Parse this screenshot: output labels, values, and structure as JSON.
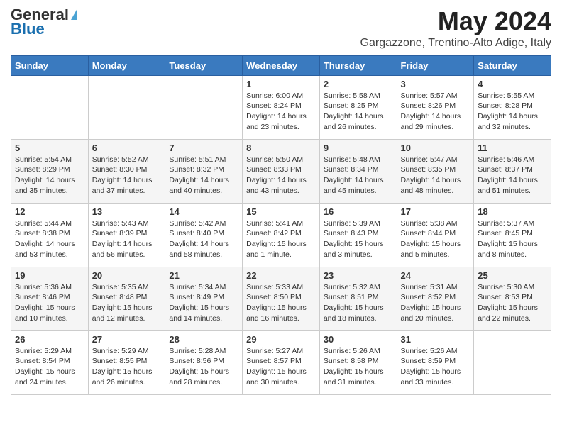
{
  "logo": {
    "general": "General",
    "blue": "Blue"
  },
  "header": {
    "month": "May 2024",
    "location": "Gargazzone, Trentino-Alto Adige, Italy"
  },
  "days_of_week": [
    "Sunday",
    "Monday",
    "Tuesday",
    "Wednesday",
    "Thursday",
    "Friday",
    "Saturday"
  ],
  "weeks": [
    [
      {
        "day": "",
        "info": ""
      },
      {
        "day": "",
        "info": ""
      },
      {
        "day": "",
        "info": ""
      },
      {
        "day": "1",
        "info": "Sunrise: 6:00 AM\nSunset: 8:24 PM\nDaylight: 14 hours\nand 23 minutes."
      },
      {
        "day": "2",
        "info": "Sunrise: 5:58 AM\nSunset: 8:25 PM\nDaylight: 14 hours\nand 26 minutes."
      },
      {
        "day": "3",
        "info": "Sunrise: 5:57 AM\nSunset: 8:26 PM\nDaylight: 14 hours\nand 29 minutes."
      },
      {
        "day": "4",
        "info": "Sunrise: 5:55 AM\nSunset: 8:28 PM\nDaylight: 14 hours\nand 32 minutes."
      }
    ],
    [
      {
        "day": "5",
        "info": "Sunrise: 5:54 AM\nSunset: 8:29 PM\nDaylight: 14 hours\nand 35 minutes."
      },
      {
        "day": "6",
        "info": "Sunrise: 5:52 AM\nSunset: 8:30 PM\nDaylight: 14 hours\nand 37 minutes."
      },
      {
        "day": "7",
        "info": "Sunrise: 5:51 AM\nSunset: 8:32 PM\nDaylight: 14 hours\nand 40 minutes."
      },
      {
        "day": "8",
        "info": "Sunrise: 5:50 AM\nSunset: 8:33 PM\nDaylight: 14 hours\nand 43 minutes."
      },
      {
        "day": "9",
        "info": "Sunrise: 5:48 AM\nSunset: 8:34 PM\nDaylight: 14 hours\nand 45 minutes."
      },
      {
        "day": "10",
        "info": "Sunrise: 5:47 AM\nSunset: 8:35 PM\nDaylight: 14 hours\nand 48 minutes."
      },
      {
        "day": "11",
        "info": "Sunrise: 5:46 AM\nSunset: 8:37 PM\nDaylight: 14 hours\nand 51 minutes."
      }
    ],
    [
      {
        "day": "12",
        "info": "Sunrise: 5:44 AM\nSunset: 8:38 PM\nDaylight: 14 hours\nand 53 minutes."
      },
      {
        "day": "13",
        "info": "Sunrise: 5:43 AM\nSunset: 8:39 PM\nDaylight: 14 hours\nand 56 minutes."
      },
      {
        "day": "14",
        "info": "Sunrise: 5:42 AM\nSunset: 8:40 PM\nDaylight: 14 hours\nand 58 minutes."
      },
      {
        "day": "15",
        "info": "Sunrise: 5:41 AM\nSunset: 8:42 PM\nDaylight: 15 hours\nand 1 minute."
      },
      {
        "day": "16",
        "info": "Sunrise: 5:39 AM\nSunset: 8:43 PM\nDaylight: 15 hours\nand 3 minutes."
      },
      {
        "day": "17",
        "info": "Sunrise: 5:38 AM\nSunset: 8:44 PM\nDaylight: 15 hours\nand 5 minutes."
      },
      {
        "day": "18",
        "info": "Sunrise: 5:37 AM\nSunset: 8:45 PM\nDaylight: 15 hours\nand 8 minutes."
      }
    ],
    [
      {
        "day": "19",
        "info": "Sunrise: 5:36 AM\nSunset: 8:46 PM\nDaylight: 15 hours\nand 10 minutes."
      },
      {
        "day": "20",
        "info": "Sunrise: 5:35 AM\nSunset: 8:48 PM\nDaylight: 15 hours\nand 12 minutes."
      },
      {
        "day": "21",
        "info": "Sunrise: 5:34 AM\nSunset: 8:49 PM\nDaylight: 15 hours\nand 14 minutes."
      },
      {
        "day": "22",
        "info": "Sunrise: 5:33 AM\nSunset: 8:50 PM\nDaylight: 15 hours\nand 16 minutes."
      },
      {
        "day": "23",
        "info": "Sunrise: 5:32 AM\nSunset: 8:51 PM\nDaylight: 15 hours\nand 18 minutes."
      },
      {
        "day": "24",
        "info": "Sunrise: 5:31 AM\nSunset: 8:52 PM\nDaylight: 15 hours\nand 20 minutes."
      },
      {
        "day": "25",
        "info": "Sunrise: 5:30 AM\nSunset: 8:53 PM\nDaylight: 15 hours\nand 22 minutes."
      }
    ],
    [
      {
        "day": "26",
        "info": "Sunrise: 5:29 AM\nSunset: 8:54 PM\nDaylight: 15 hours\nand 24 minutes."
      },
      {
        "day": "27",
        "info": "Sunrise: 5:29 AM\nSunset: 8:55 PM\nDaylight: 15 hours\nand 26 minutes."
      },
      {
        "day": "28",
        "info": "Sunrise: 5:28 AM\nSunset: 8:56 PM\nDaylight: 15 hours\nand 28 minutes."
      },
      {
        "day": "29",
        "info": "Sunrise: 5:27 AM\nSunset: 8:57 PM\nDaylight: 15 hours\nand 30 minutes."
      },
      {
        "day": "30",
        "info": "Sunrise: 5:26 AM\nSunset: 8:58 PM\nDaylight: 15 hours\nand 31 minutes."
      },
      {
        "day": "31",
        "info": "Sunrise: 5:26 AM\nSunset: 8:59 PM\nDaylight: 15 hours\nand 33 minutes."
      },
      {
        "day": "",
        "info": ""
      }
    ]
  ]
}
